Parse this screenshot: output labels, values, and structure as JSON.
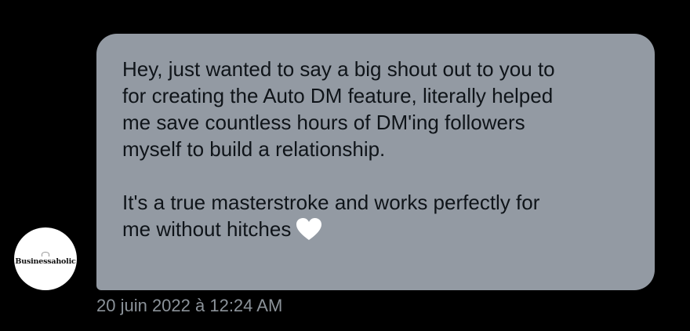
{
  "sender": {
    "avatar_label": "Businessaholic"
  },
  "message": {
    "paragraph_1": "Hey, just wanted to say a big shout out to you to\nfor creating the Auto DM feature, literally helped\nme save countless hours of DM'ing followers\nmyself to build a relationship.",
    "paragraph_2": "It's a true masterstroke and works perfectly for\nme without hitches",
    "emoji_icon": "white-heart-icon",
    "timestamp": "20 juin 2022 à 12:24 AM"
  },
  "colors": {
    "background": "#000000",
    "bubble": "#939aa3",
    "text": "#0f1419",
    "timestamp": "#8b9299",
    "heart": "#ffffff"
  }
}
